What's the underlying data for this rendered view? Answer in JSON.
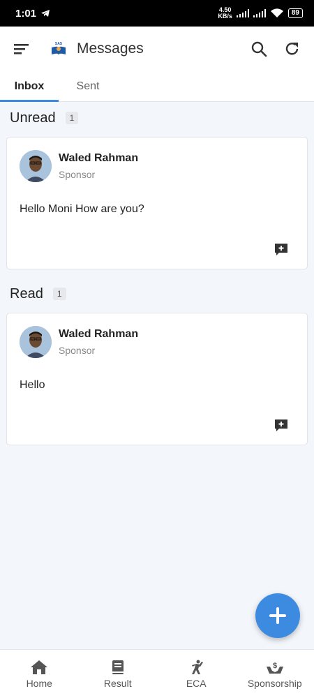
{
  "status_bar": {
    "time": "1:01",
    "speed_value": "4.50",
    "speed_unit": "KB/s",
    "battery": "89"
  },
  "app_bar": {
    "title": "Messages",
    "logo_text": "SAS"
  },
  "tabs": [
    {
      "label": "Inbox",
      "active": true
    },
    {
      "label": "Sent",
      "active": false
    }
  ],
  "sections": [
    {
      "title": "Unread",
      "count": "1",
      "messages": [
        {
          "sender": "Waled Rahman",
          "role": "Sponsor",
          "body": "Hello Moni How are you?"
        }
      ]
    },
    {
      "title": "Read",
      "count": "1",
      "messages": [
        {
          "sender": "Waled Rahman",
          "role": "Sponsor",
          "body": "Hello"
        }
      ]
    }
  ],
  "bottom_nav": [
    {
      "label": "Home",
      "icon": "home-icon"
    },
    {
      "label": "Result",
      "icon": "book-icon"
    },
    {
      "label": "ECA",
      "icon": "activity-icon"
    },
    {
      "label": "Sponsorship",
      "icon": "sponsorship-icon"
    }
  ],
  "colors": {
    "accent": "#3d8be0",
    "background": "#f3f6fa"
  }
}
